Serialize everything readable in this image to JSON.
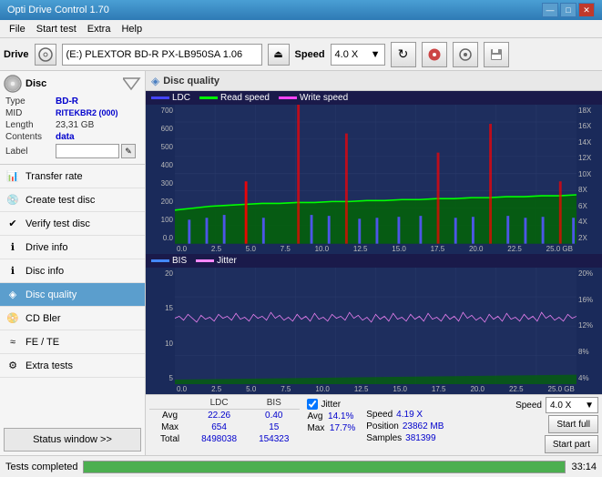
{
  "titlebar": {
    "title": "Opti Drive Control 1.70",
    "minimize": "—",
    "maximize": "□",
    "close": "✕"
  },
  "menubar": {
    "items": [
      "File",
      "Start test",
      "Extra",
      "Help"
    ]
  },
  "drivebar": {
    "label": "Drive",
    "drive_value": "(E:)  PLEXTOR BD-R  PX-LB950SA 1.06",
    "speed_label": "Speed",
    "speed_value": "4.0 X"
  },
  "disc": {
    "title": "Disc",
    "rows": [
      {
        "label": "Type",
        "value": "BD-R",
        "blue": true
      },
      {
        "label": "MID",
        "value": "RITEKBR2 (000)",
        "blue": true
      },
      {
        "label": "Length",
        "value": "23,31 GB",
        "blue": false
      },
      {
        "label": "Contents",
        "value": "data",
        "blue": true
      }
    ],
    "label_row": {
      "label": "Label",
      "value": ""
    }
  },
  "sidebar": {
    "items": [
      {
        "label": "Transfer rate",
        "active": false
      },
      {
        "label": "Create test disc",
        "active": false
      },
      {
        "label": "Verify test disc",
        "active": false
      },
      {
        "label": "Drive info",
        "active": false
      },
      {
        "label": "Disc info",
        "active": false
      },
      {
        "label": "Disc quality",
        "active": true
      },
      {
        "label": "CD Bler",
        "active": false
      },
      {
        "label": "FE / TE",
        "active": false
      },
      {
        "label": "Extra tests",
        "active": false
      }
    ],
    "status_btn": "Status window >>"
  },
  "chart": {
    "title": "Disc quality",
    "legend_upper": [
      "LDC",
      "Read speed",
      "Write speed"
    ],
    "legend_lower": [
      "BIS",
      "Jitter"
    ],
    "upper_y_left": [
      "700",
      "600",
      "500",
      "400",
      "300",
      "200",
      "100",
      "0.0"
    ],
    "upper_y_right": [
      "18X",
      "16X",
      "14X",
      "12X",
      "10X",
      "8X",
      "6X",
      "4X",
      "2X"
    ],
    "lower_y_left": [
      "20",
      "15",
      "10",
      "5"
    ],
    "lower_y_right": [
      "20%",
      "16%",
      "12%",
      "8%",
      "4%"
    ],
    "x_axis": [
      "0.0",
      "2.5",
      "5.0",
      "7.5",
      "10.0",
      "12.5",
      "15.0",
      "17.5",
      "20.0",
      "22.5",
      "25.0"
    ],
    "x_unit": "GB"
  },
  "stats": {
    "headers": [
      "LDC",
      "BIS",
      "",
      "Jitter",
      "Speed"
    ],
    "avg": {
      "ldc": "22.26",
      "bis": "0.40",
      "jitter": "14.1%"
    },
    "max": {
      "ldc": "654",
      "bis": "15",
      "jitter": "17.7%"
    },
    "total": {
      "ldc": "8498038",
      "bis": "154323"
    },
    "speed_value": "4.19 X",
    "speed_label": "Speed",
    "position_label": "Position",
    "position_value": "23862 MB",
    "samples_label": "Samples",
    "samples_value": "381399",
    "speed_select": "4.0 X",
    "start_full": "Start full",
    "start_part": "Start part"
  },
  "statusbar": {
    "text": "Tests completed",
    "progress": 100,
    "time": "33:14"
  }
}
